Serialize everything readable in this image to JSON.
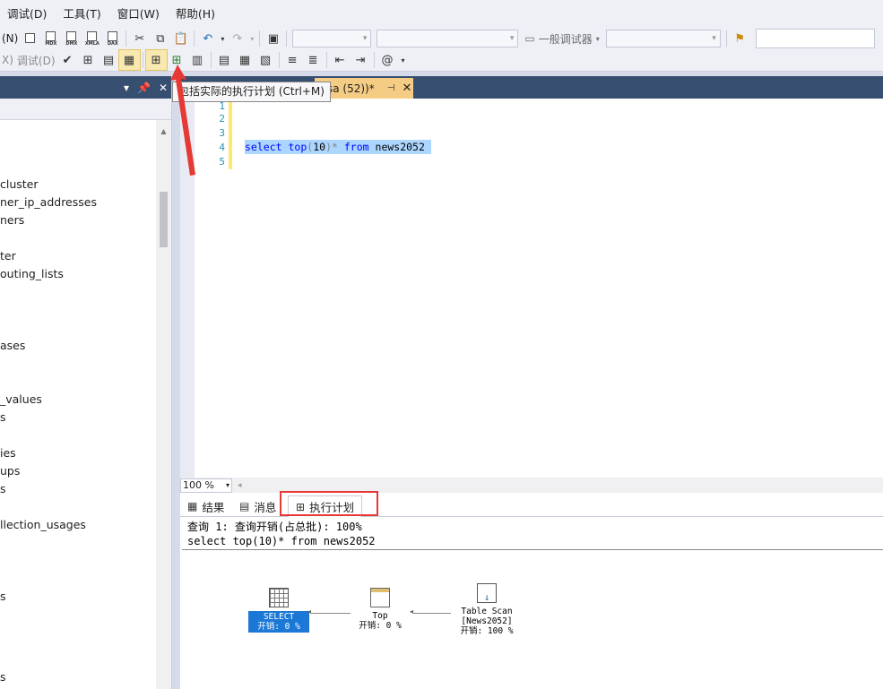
{
  "menubar": {
    "items": [
      {
        "label": "调试(D)"
      },
      {
        "label": "工具(T)"
      },
      {
        "label": "窗口(W)"
      },
      {
        "label": "帮助(H)"
      }
    ]
  },
  "toolbar1": {
    "left_fragment": "(N)",
    "mdx": "MDX",
    "dmx": "DMX",
    "xmla": "XMLA",
    "dax": "DAX",
    "debugger_label": "一般调试器"
  },
  "toolbar2": {
    "left_fragment": "X)",
    "debug_label": "调试(D)"
  },
  "tooltip": {
    "text": "包括实际的执行计划 (Ctrl+M)"
  },
  "doc_tab": {
    "title": "sa (52))*",
    "pin_icon": "pin-icon",
    "close_icon": "close-icon"
  },
  "explorer": {
    "title_pin": "▾",
    "tree_items": [
      "cluster",
      "ner_ip_addresses",
      "ners",
      "ter",
      "outing_lists",
      "ases",
      "_values",
      "s",
      "ies",
      "ups",
      "s",
      "llection_usages",
      "s",
      "s"
    ]
  },
  "editor": {
    "line_numbers": [
      "1",
      "2",
      "3",
      "4",
      "5"
    ],
    "code": {
      "kw_select": "select",
      "kw_top": "top",
      "open": "(",
      "num": "10",
      "close": ")",
      "star": "*",
      "kw_from": "from",
      "table": "news2052"
    }
  },
  "zoom": {
    "value": "100 %"
  },
  "results_tabs": {
    "results": "结果",
    "messages": "消息",
    "plan": "执行计划"
  },
  "plan": {
    "query_line": "查询 1: 查询开销(占总批): 100%",
    "sql_line": "select top(10)* from news2052",
    "operators": [
      {
        "name": "SELECT",
        "cost": "开销: 0 %"
      },
      {
        "name": "Top",
        "cost": "开销: 0 %"
      },
      {
        "name": "Table Scan",
        "object": "[News2052]",
        "cost": "开销: 100 %"
      }
    ]
  },
  "colors": {
    "accent_dark": "#364e6f",
    "tab_active": "#f5cc84",
    "selection": "#add6ff",
    "annotation_red": "#e53935"
  }
}
